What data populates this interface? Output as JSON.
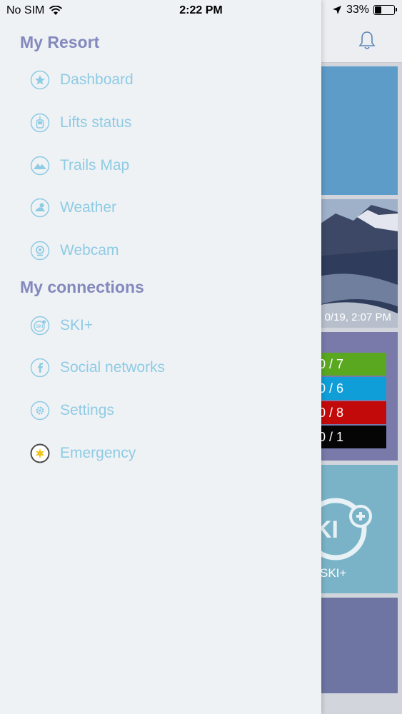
{
  "status_bar": {
    "carrier": "No SIM",
    "time": "2:22 PM",
    "battery": "33%",
    "battery_level": 0.33
  },
  "drawer": {
    "sections": [
      {
        "title": "My Resort",
        "items": [
          {
            "label": "Dashboard",
            "icon": "star-icon"
          },
          {
            "label": "Lifts status",
            "icon": "gondola-icon"
          },
          {
            "label": "Trails Map",
            "icon": "mountain-icon"
          },
          {
            "label": "Weather",
            "icon": "weather-icon"
          },
          {
            "label": "Webcam",
            "icon": "webcam-icon"
          }
        ]
      },
      {
        "title": "My connections",
        "items": [
          {
            "label": "SKI+",
            "icon": "ski-plus-icon"
          },
          {
            "label": "Social networks",
            "icon": "facebook-icon"
          },
          {
            "label": "Settings",
            "icon": "gear-icon"
          },
          {
            "label": "Emergency",
            "icon": "emergency-icon"
          }
        ]
      }
    ]
  },
  "background": {
    "webcam_time": "0/19, 2:07 PM",
    "trails": [
      {
        "text": "0 / 7",
        "color": "#5aa820"
      },
      {
        "text": "0 / 6",
        "color": "#0f9ed8"
      },
      {
        "text": "0 / 8",
        "color": "#c30a0a"
      },
      {
        "text": "0 / 1",
        "color": "#050505"
      }
    ],
    "ski_label": "SKI+"
  },
  "colors": {
    "section_title": "#8389bd",
    "menu_label": "#8ecbe4",
    "drawer_bg": "#eff2f5"
  }
}
